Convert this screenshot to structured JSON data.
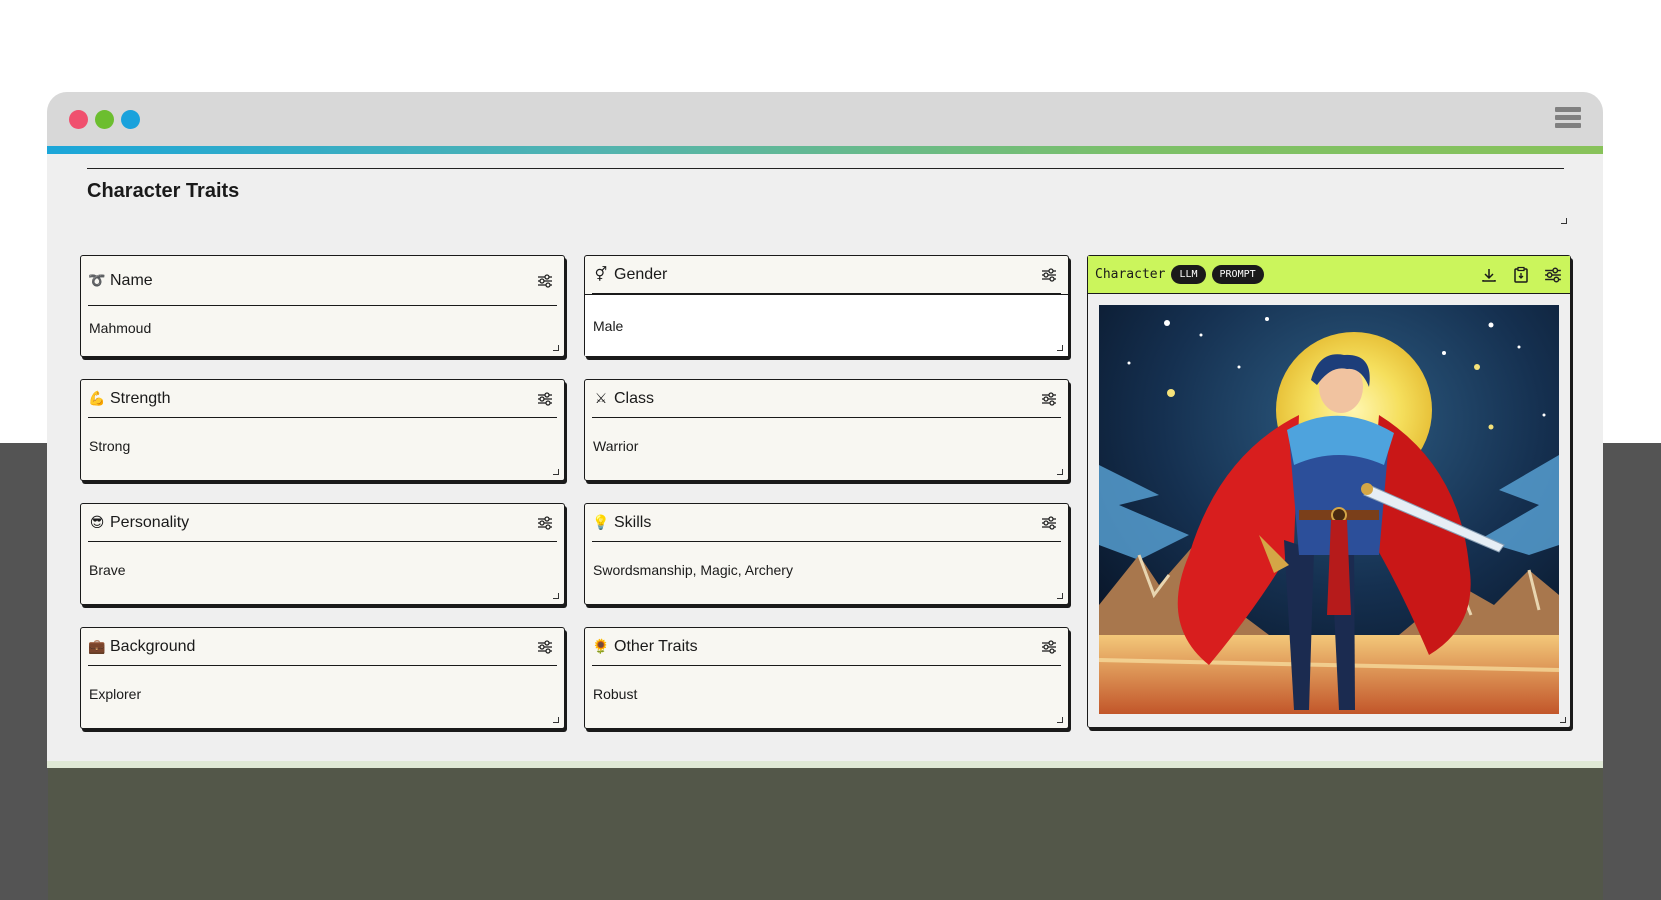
{
  "window": {
    "controls": [
      "close",
      "minimize",
      "maximize"
    ],
    "menu_icon": "hamburger-icon"
  },
  "section": {
    "title": "Character Traits"
  },
  "traits": {
    "name": {
      "emoji": "➰",
      "label": "Name",
      "value": "Mahmoud"
    },
    "gender": {
      "emoji": "⚥",
      "label": "Gender",
      "value": "Male"
    },
    "strength": {
      "emoji": "💪",
      "label": "Strength",
      "value": "Strong"
    },
    "class": {
      "emoji": "⚔",
      "label": "Class",
      "value": "Warrior"
    },
    "personality": {
      "emoji": "😎",
      "label": "Personality",
      "value": "Brave"
    },
    "skills": {
      "emoji": "💡",
      "label": "Skills",
      "value": "Swordsmanship, Magic, Archery"
    },
    "background": {
      "emoji": "💼",
      "label": "Background",
      "value": "Explorer"
    },
    "other": {
      "emoji": "🌻",
      "label": "Other Traits",
      "value": "Robust"
    }
  },
  "character_panel": {
    "title": "Character",
    "badges": [
      "LLM",
      "PROMPT"
    ],
    "icons": [
      "download-icon",
      "copy-icon",
      "settings-icon"
    ],
    "image": "hero-illustration"
  },
  "colors": {
    "accent": "#cbf55c",
    "gradient_start": "#1ba6d9",
    "gradient_end": "#88c25a",
    "dot_red": "#f0506e",
    "dot_green": "#6cbe2f",
    "dot_blue": "#1aa2dc"
  }
}
